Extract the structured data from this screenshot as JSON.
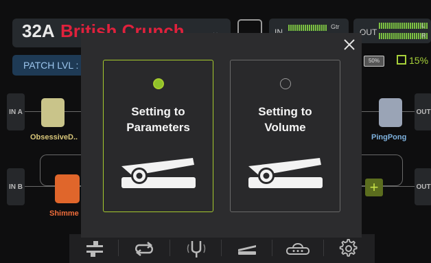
{
  "header": {
    "patch_number": "32A",
    "patch_name": "British Crunch",
    "dropdown_glyph": "⌄",
    "input_meter": {
      "label": "IN",
      "channel": "Gtr"
    },
    "output_meter": {
      "label": "OUT",
      "left": "L",
      "right": "R"
    },
    "patch_level_label": "PATCH LVL :",
    "battery": "50%",
    "cpu": "15%"
  },
  "chain": {
    "in_a": "IN A",
    "in_b": "IN B",
    "out_a": "OUT",
    "out_b": "OUT",
    "pedal_a": "ObsessiveD..",
    "pedal_b": "Shimme",
    "pedal_c": "PingPong",
    "add_glyph": "+"
  },
  "modal": {
    "close_glyph": "✕",
    "options": [
      {
        "title_line1": "Setting to",
        "title_line2": "Parameters",
        "selected": true
      },
      {
        "title_line1": "Setting to",
        "title_line2": "Volume",
        "selected": false
      }
    ]
  },
  "toolbar": {
    "icons": [
      "signal-chain-icon",
      "looper-icon",
      "tuner-icon",
      "expression-pedal-icon",
      "footswitch-icon",
      "settings-gear-icon"
    ]
  },
  "colors": {
    "accent_green": "#a7cc2e",
    "patch_red": "#e0213c",
    "meter_green": "#7cc242"
  }
}
